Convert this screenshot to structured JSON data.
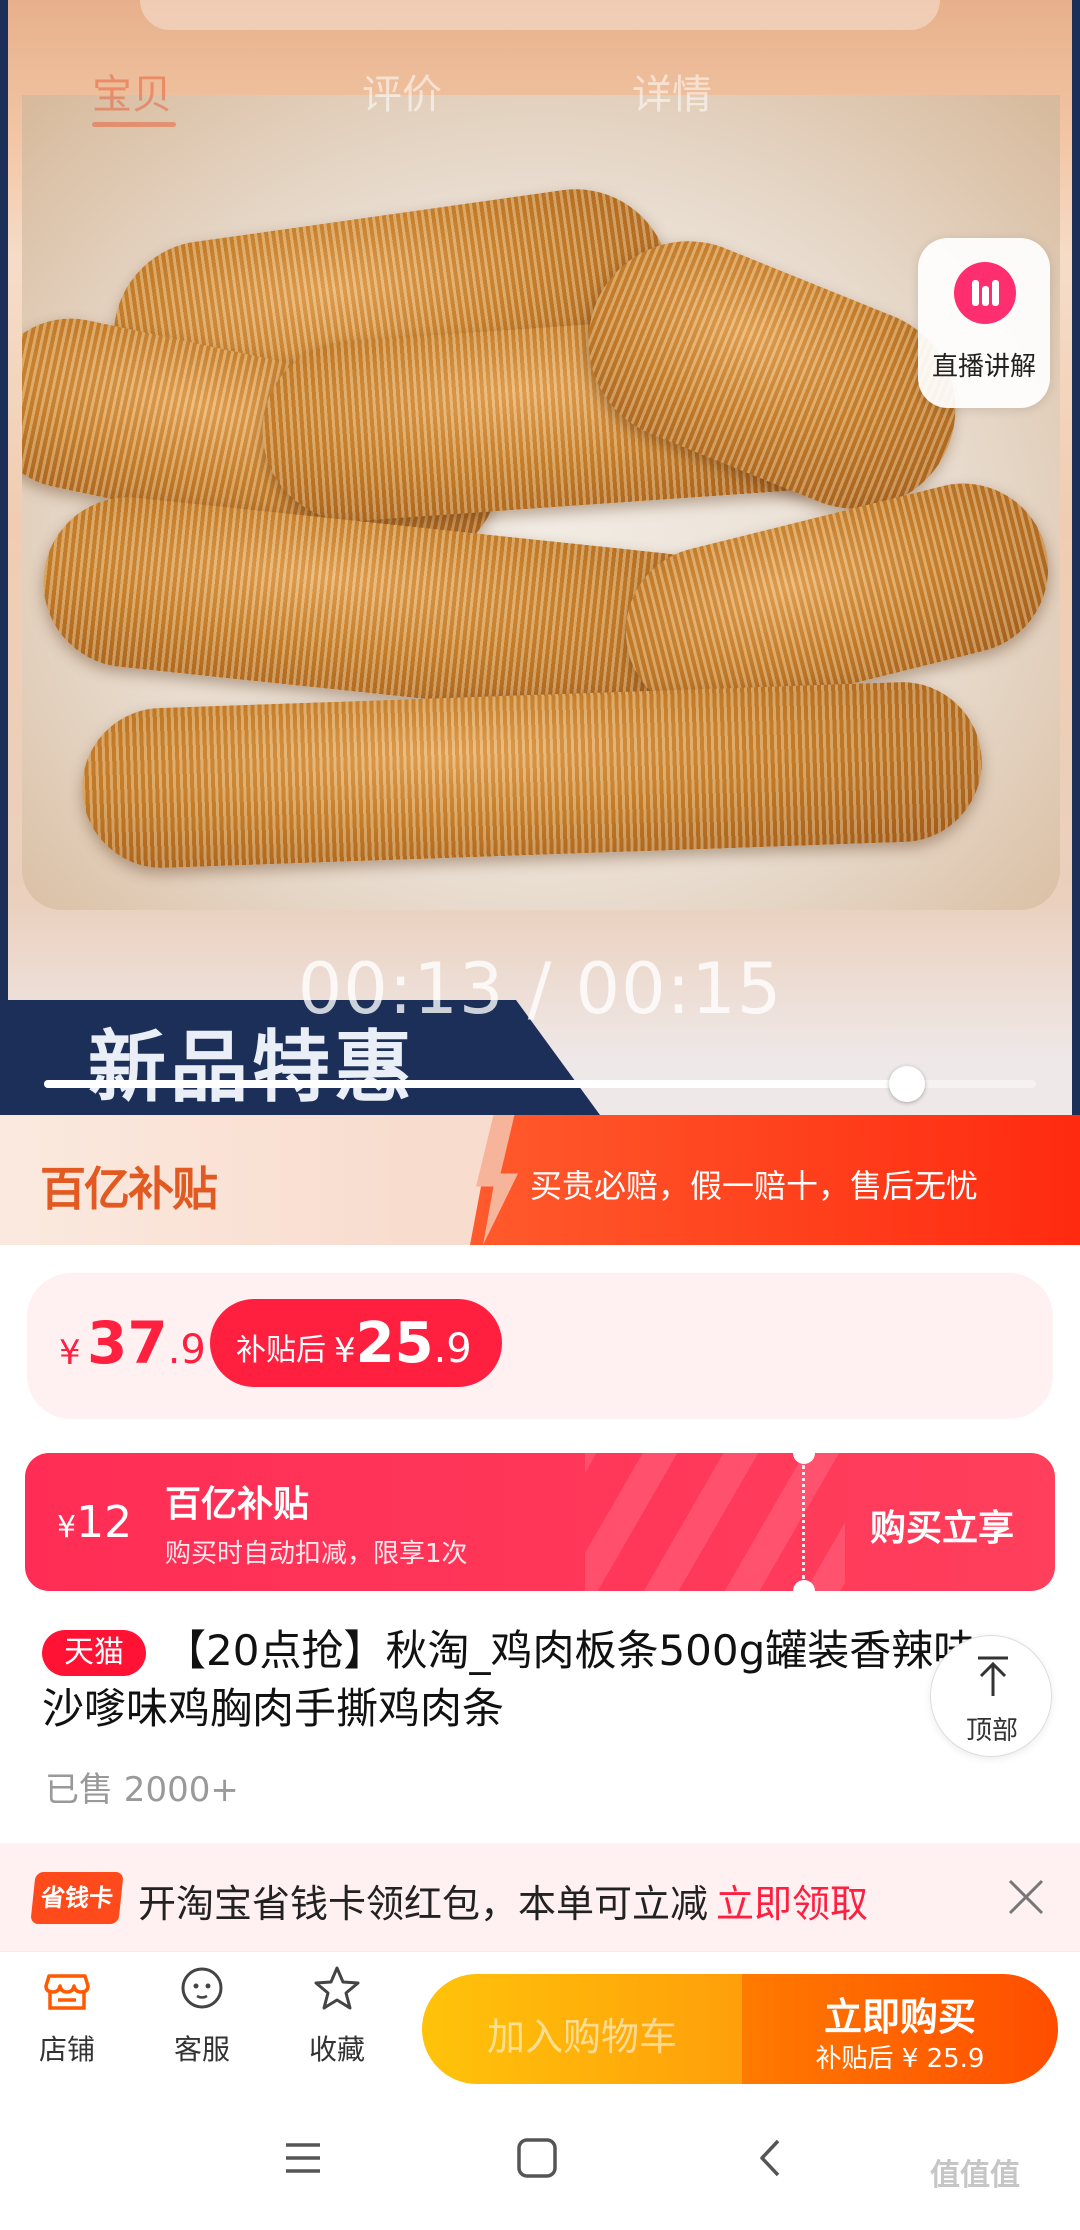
{
  "tabs": [
    {
      "label": "宝贝",
      "active": true
    },
    {
      "label": "评价",
      "active": false
    },
    {
      "label": "详情",
      "active": false
    }
  ],
  "media": {
    "live_label": "直播讲解",
    "banner_text": "新品特惠",
    "time": "00:13 / 00:15",
    "progress": 0.87
  },
  "subsidy_banner": {
    "logo": "百亿补贴",
    "slogan": "买贵必赔，假一赔十，售后无忧"
  },
  "price": {
    "currency": "¥",
    "integer": "37",
    "decimal": ".9",
    "after_label": "补贴后",
    "after_currency": "¥",
    "after_integer": "25",
    "after_decimal": ".9"
  },
  "coupon": {
    "currency": "¥",
    "amount": "12",
    "title": "百亿补贴",
    "subtitle": "购买时自动扣减，限享1次",
    "action": "购买立享"
  },
  "product": {
    "badge": "天猫",
    "title": "【20点抢】秋淘_鸡肉板条500g罐装香辣味沙嗲味鸡胸肉手撕鸡肉条",
    "sold": "已售 2000+"
  },
  "to_top_label": "顶部",
  "saving_card": {
    "badge": "省钱卡",
    "text": "开淘宝省钱卡领红包，本单可立减",
    "link": "立即领取"
  },
  "bottom_bar": {
    "shop": "店铺",
    "service": "客服",
    "favorite": "收藏",
    "add_to_cart": "加入购物车",
    "buy_now": "立即购买",
    "buy_sub": "补贴后 ¥ 25.9"
  },
  "watermark": "值值值",
  "colors": {
    "accent_red": "#ff1f3f",
    "buy_orange": "#ff5a00",
    "cart_yellow": "#ffb30a"
  }
}
